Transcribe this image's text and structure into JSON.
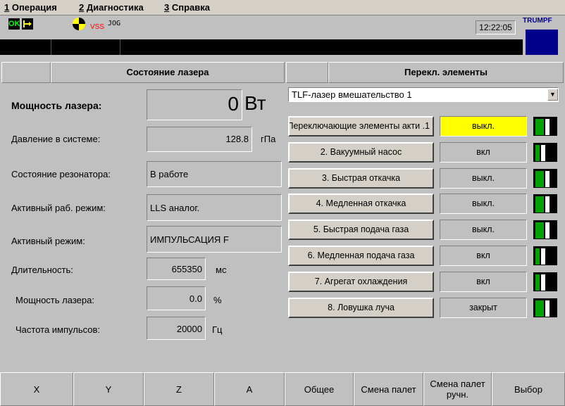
{
  "menu": [
    {
      "key": "1",
      "label": " Операция"
    },
    {
      "key": "2",
      "label": " Диагностика"
    },
    {
      "key": "3",
      "label": " Справка"
    }
  ],
  "status": {
    "ok": "OK",
    "vss": "VSS",
    "jog": "JOG",
    "clock": "12:22:05",
    "brand": "TRUMPF",
    "brand_color": "#00008b"
  },
  "left_panel": {
    "title": "Состояние лазера",
    "laser_power_label": "Мощность лазера:",
    "laser_power_value": "0",
    "laser_power_unit": "Вт",
    "pressure_label": "Давление в системе:",
    "pressure_value": "128.8",
    "pressure_unit": "гПа",
    "resonator_label": "Состояние резонатора:",
    "resonator_value": "В работе",
    "active_work_mode_label": "Активный раб. режим:",
    "active_work_mode_value": "LLS аналог.",
    "active_mode_label": "Активный режим:",
    "active_mode_value": "ИМПУЛЬСАЦИЯ F",
    "duration_label": "Длительность:",
    "duration_value": "655350",
    "duration_unit": "мс",
    "power_pct_label": "Мощность лазера:",
    "power_pct_value": "0.0",
    "power_pct_unit": "%",
    "pulse_freq_label": "Частота импульсов:",
    "pulse_freq_value": "20000",
    "pulse_freq_unit": "Гц"
  },
  "right_panel": {
    "title": "Перекл. элементы",
    "dropdown_value": "TLF-лазер вмешательство 1",
    "rows": [
      {
        "label": "1. Переключающие элементы акти",
        "status": "выкл.",
        "highlight": true,
        "on": false
      },
      {
        "label": "2. Вакуумный насос",
        "status": "вкл",
        "highlight": false,
        "on": true
      },
      {
        "label": "3. Быстрая откачка",
        "status": "выкл.",
        "highlight": false,
        "on": false
      },
      {
        "label": "4. Медленная откачка",
        "status": "выкл.",
        "highlight": false,
        "on": false
      },
      {
        "label": "5. Быстрая подача газа",
        "status": "выкл.",
        "highlight": false,
        "on": false
      },
      {
        "label": "6. Медленная подача газа",
        "status": "вкл",
        "highlight": false,
        "on": true
      },
      {
        "label": "7. Агрегат охлаждения",
        "status": "вкл",
        "highlight": false,
        "on": true
      },
      {
        "label": "8. Ловушка луча",
        "status": "закрыт",
        "highlight": false,
        "on": false
      }
    ]
  },
  "bottom_buttons": [
    "X",
    "Y",
    "Z",
    "A",
    "Общее",
    "Смена палет",
    "Смена палет ручн.",
    "Выбор"
  ]
}
